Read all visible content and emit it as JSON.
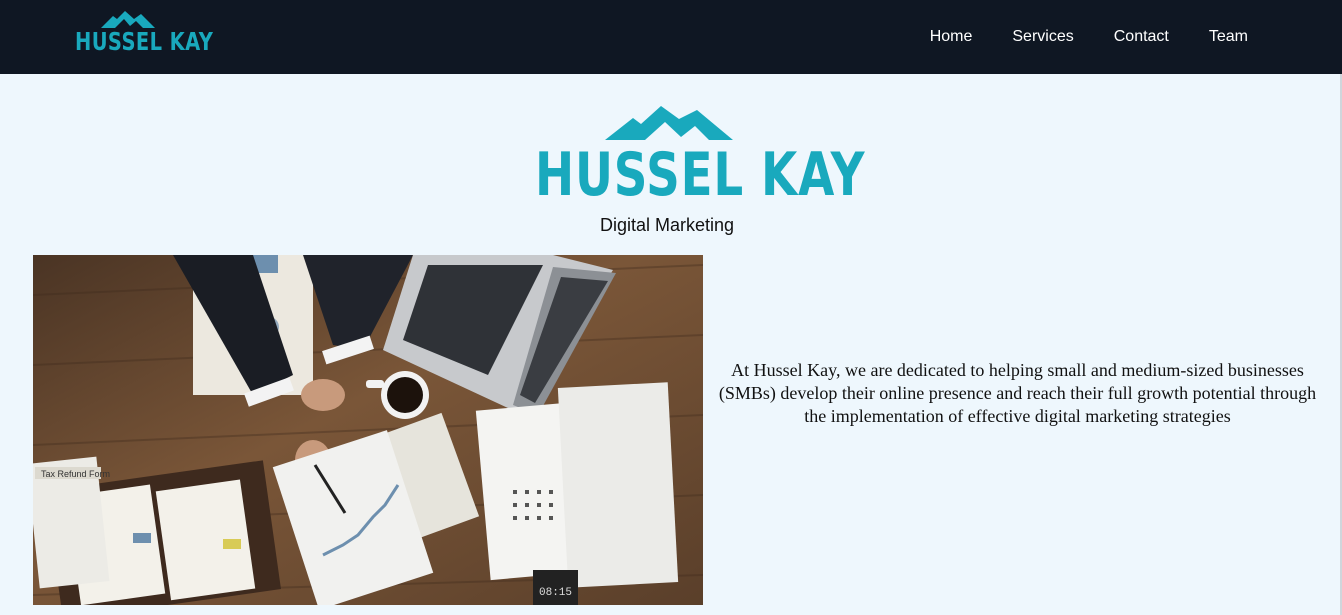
{
  "colors": {
    "nav_background": "#0f1723",
    "page_background": "#eef7fd",
    "brand_teal": "#19a9bd"
  },
  "nav": {
    "logo_text": "HUSSEL KAY",
    "links": [
      "Home",
      "Services",
      "Contact",
      "Team"
    ]
  },
  "hero": {
    "logo_text": "HUSSEL KAY",
    "tagline": "Digital Marketing"
  },
  "about": {
    "description": "At Hussel Kay, we are dedicated to helping small and medium-sized businesses (SMBs) develop their online presence and reach their full growth potential through the implementation of effective digital marketing strategies"
  },
  "icons": {
    "logo_mark": "mountain-icon"
  },
  "photo": {
    "clock_time": "08:15",
    "document_title": "Tax Refund Form"
  }
}
